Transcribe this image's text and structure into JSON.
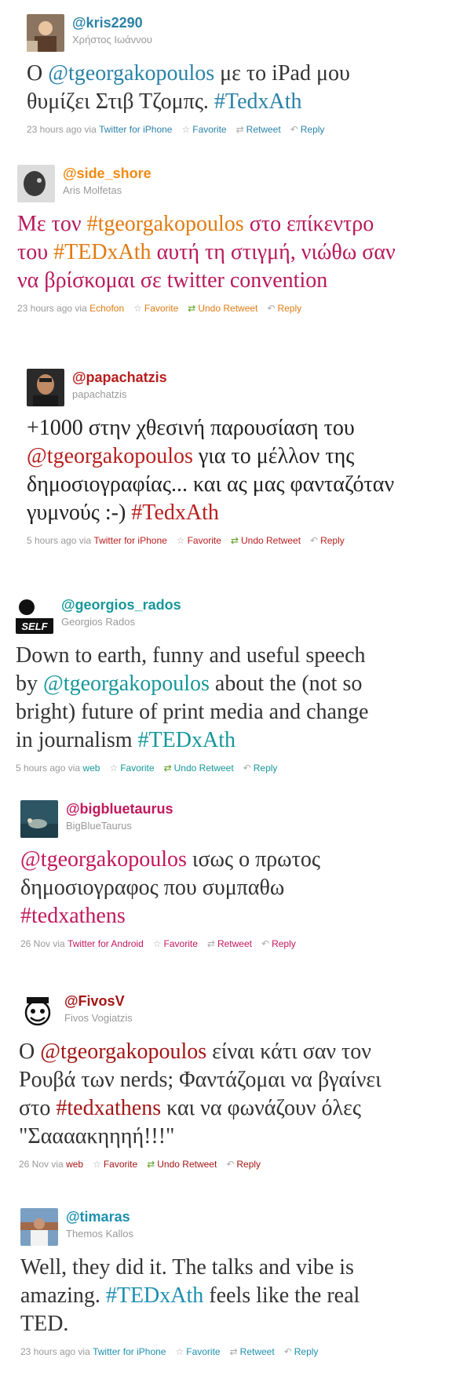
{
  "tweets": [
    {
      "handle": "@kris2290",
      "name": "Χρήστος Ιωάννου",
      "handle_color": "#2a82a8",
      "text_color": "#333333",
      "link_color": "#2a82a8",
      "lines": [
        [
          {
            "t": "Ο "
          },
          {
            "t": "@tgeorgakopoulos",
            "link": true
          },
          {
            "t": " με το iPad μου"
          }
        ],
        [
          {
            "t": "θυμίζει Στιβ Τζομπς. "
          },
          {
            "t": "#TedxAth",
            "link": true
          }
        ]
      ],
      "meta": {
        "time": "23 hours ago",
        "via": "via",
        "client": "Twitter for iPhone",
        "favorite": "Favorite",
        "retweet": "Retweet",
        "retweet_undo": false,
        "reply": "Reply"
      }
    },
    {
      "handle": "@side_shore",
      "name": "Aris Molfetas",
      "handle_color": "#f08a12",
      "text_color": "#b8195a",
      "link_color": "#e07b12",
      "lines": [
        [
          {
            "t": "Με τον "
          },
          {
            "t": "#tgeorgakopoulos",
            "link": true
          },
          {
            "t": " στο επίκεντρο"
          }
        ],
        [
          {
            "t": "του "
          },
          {
            "t": "#TEDxAth",
            "link": true
          },
          {
            "t": " αυτή τη στιγμή, νιώθω σαν"
          }
        ],
        [
          {
            "t": "να βρίσκομαι σε twitter convention"
          }
        ]
      ],
      "meta": {
        "time": "23 hours ago",
        "via": "via",
        "client": "Echofon",
        "favorite": "Favorite",
        "retweet": "Undo Retweet",
        "retweet_undo": true,
        "reply": "Reply"
      }
    },
    {
      "handle": "@papachatzis",
      "name": "papachatzis",
      "handle_color": "#b81d1d",
      "text_color": "#222222",
      "link_color": "#b81d1d",
      "lines": [
        [
          {
            "t": "+1000 στην χθεσινή παρουσίαση του"
          }
        ],
        [
          {
            "t": "@tgeorgakopoulos",
            "link": true
          },
          {
            "t": " για το μέλλον της"
          }
        ],
        [
          {
            "t": "δημοσιογραφίας... και ας μας φανταζόταν"
          }
        ],
        [
          {
            "t": "γυμνούς :-) "
          },
          {
            "t": "#TedxAth",
            "link": true
          }
        ]
      ],
      "meta": {
        "time": "5 hours ago",
        "via": "via",
        "client": "Twitter for iPhone",
        "favorite": "Favorite",
        "retweet": "Undo Retweet",
        "retweet_undo": true,
        "reply": "Reply"
      }
    },
    {
      "handle": "@georgios_rados",
      "name": "Georgios Rados",
      "handle_color": "#16979a",
      "text_color": "#333333",
      "link_color": "#16979a",
      "lines": [
        [
          {
            "t": "Down to earth, funny and useful speech"
          }
        ],
        [
          {
            "t": "by "
          },
          {
            "t": "@tgeorgakopoulos",
            "link": true
          },
          {
            "t": " about the (not so"
          }
        ],
        [
          {
            "t": "bright) future of print media and change"
          }
        ],
        [
          {
            "t": "in journalism "
          },
          {
            "t": "#TEDxAth",
            "link": true
          }
        ]
      ],
      "meta": {
        "time": "5 hours ago",
        "via": "via",
        "client": "web",
        "favorite": "Favorite",
        "retweet": "Undo Retweet",
        "retweet_undo": true,
        "reply": "Reply"
      }
    },
    {
      "handle": "@bigbluetaurus",
      "name": "BigBlueTaurus",
      "handle_color": "#c2185b",
      "text_color": "#333333",
      "link_color": "#c2185b",
      "lines": [
        [
          {
            "t": "@tgeorgakopoulos",
            "link": true
          },
          {
            "t": " ισως ο πρωτος"
          }
        ],
        [
          {
            "t": "δημοσιογραφος που συμπαθω"
          }
        ],
        [
          {
            "t": "#tedxathens",
            "link": true
          }
        ]
      ],
      "meta": {
        "time": "26 Nov",
        "via": "via",
        "client": "Twitter for Android",
        "favorite": "Favorite",
        "retweet": "Retweet",
        "retweet_undo": false,
        "reply": "Reply"
      }
    },
    {
      "handle": "@FivosV",
      "name": "Fivos Vogiatzis",
      "handle_color": "#a31515",
      "text_color": "#333333",
      "link_color": "#a31515",
      "lines": [
        [
          {
            "t": "Ο "
          },
          {
            "t": "@tgeorgakopoulos",
            "link": true
          },
          {
            "t": " είναι κάτι σαν τον"
          }
        ],
        [
          {
            "t": "Ρουβά των nerds; Φαντάζομαι να βγαίνει"
          }
        ],
        [
          {
            "t": "στο "
          },
          {
            "t": "#tedxathens",
            "link": true
          },
          {
            "t": " και να φωνάζουν όλες"
          }
        ],
        [
          {
            "t": "\"Σαααακηηηή!!!\""
          }
        ]
      ],
      "meta": {
        "time": "26 Nov",
        "via": "via",
        "client": "web",
        "favorite": "Favorite",
        "retweet": "Undo Retweet",
        "retweet_undo": true,
        "reply": "Reply"
      }
    },
    {
      "handle": "@timaras",
      "name": "Themos Kallos",
      "handle_color": "#1d8fb0",
      "text_color": "#333333",
      "link_color": "#1d8fb0",
      "lines": [
        [
          {
            "t": "Well, they did it. The talks and vibe is"
          }
        ],
        [
          {
            "t": "amazing. "
          },
          {
            "t": "#TEDxAth",
            "link": true
          },
          {
            "t": " feels like the real"
          }
        ],
        [
          {
            "t": "TED."
          }
        ]
      ],
      "meta": {
        "time": "23 hours ago",
        "via": "via",
        "client": "Twitter for iPhone",
        "favorite": "Favorite",
        "retweet": "Retweet",
        "retweet_undo": false,
        "reply": "Reply"
      }
    }
  ]
}
